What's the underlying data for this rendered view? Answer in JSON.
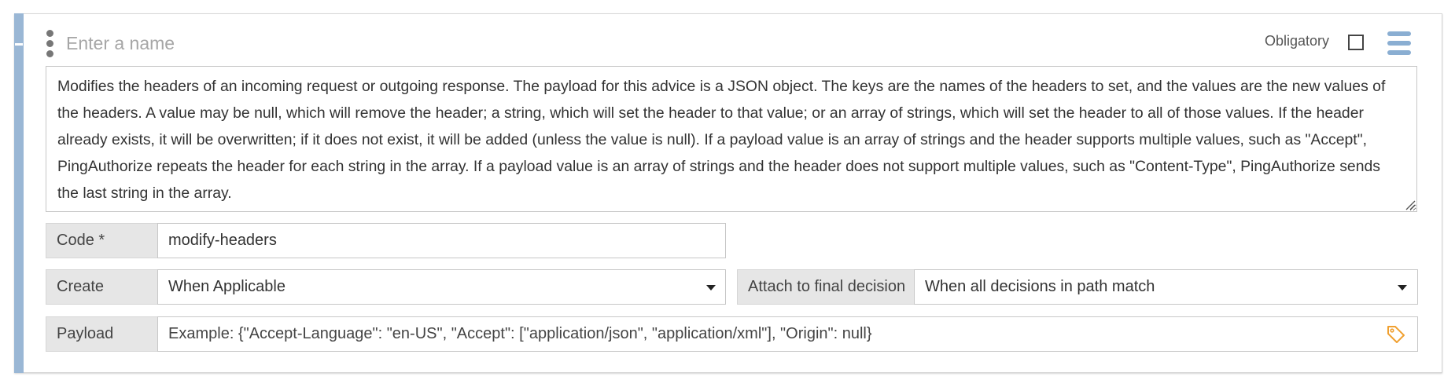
{
  "header": {
    "name_placeholder": "Enter a name",
    "obligatory_label": "Obligatory",
    "obligatory_checked": false
  },
  "description": "Modifies the headers of an incoming request or outgoing response. The payload for this advice is a JSON object. The keys are the names of the headers to set, and the values are the new values of the headers. A value may be null, which will remove the header; a string, which will set the header to that value; or an array of strings, which will set the header to all of those values. If the header already exists, it will be overwritten; if it does not exist, it will be added (unless the value is null). If a payload value is an array of strings and the header supports multiple values, such as \"Accept\", PingAuthorize repeats the header for each string in the array. If a payload value is an array of strings and the header does not support multiple values, such as \"Content-Type\", PingAuthorize sends the last string in the array.",
  "fields": {
    "code_label": "Code *",
    "code_value": "modify-headers",
    "create_label": "Create",
    "create_value": "When Applicable",
    "attach_label": "Attach to final decision",
    "attach_value": "When all decisions in path match",
    "payload_label": "Payload",
    "payload_placeholder": "Example: {\"Accept-Language\": \"en-US\", \"Accept\": [\"application/json\", \"application/xml\"], \"Origin\": null}"
  },
  "icons": {
    "kebab": "vertical-dots-icon",
    "menu": "hamburger-icon",
    "payload_tag": "tag-icon"
  },
  "colors": {
    "accent": "#9ab7d5",
    "menu_icon": "#8aaed2",
    "tag_icon": "#f0a030",
    "label_bg": "#e6e6e6"
  }
}
